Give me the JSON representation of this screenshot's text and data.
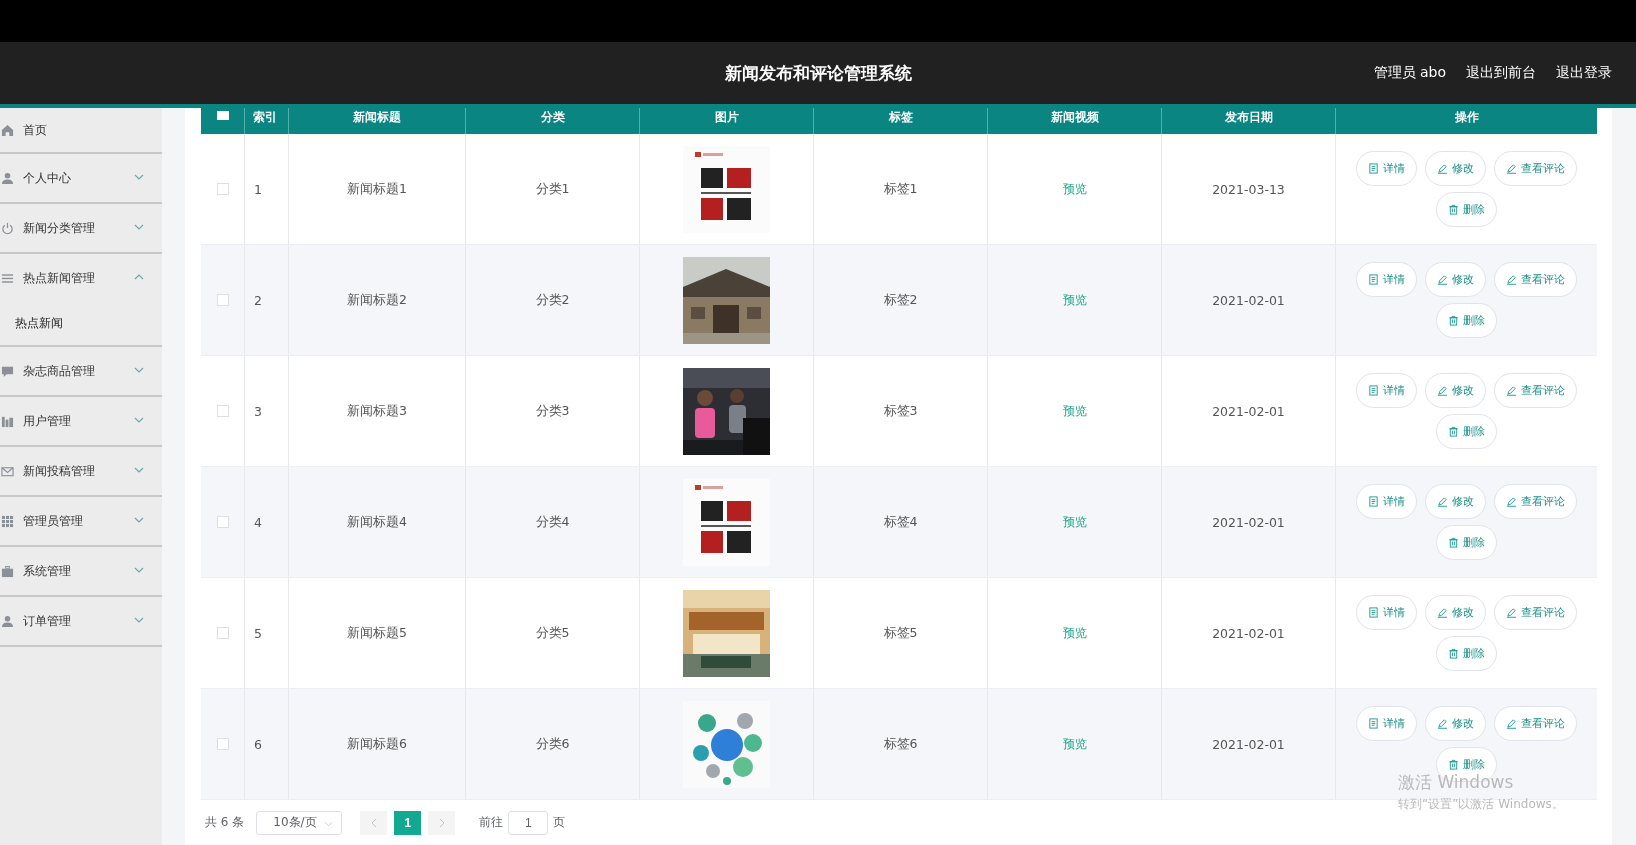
{
  "header": {
    "title": "新闻发布和评论管理系统",
    "user": "管理员 abo",
    "links": [
      "退出到前台",
      "退出登录"
    ]
  },
  "sidebar": {
    "items": [
      {
        "label": "首页",
        "has_children": false
      },
      {
        "label": "个人中心",
        "expanded": false,
        "has_children": true
      },
      {
        "label": "新闻分类管理",
        "expanded": false,
        "has_children": true
      },
      {
        "label": "热点新闻管理",
        "expanded": true,
        "has_children": true,
        "children": [
          {
            "label": "热点新闻"
          }
        ]
      },
      {
        "label": "杂志商品管理",
        "expanded": false,
        "has_children": true
      },
      {
        "label": "用户管理",
        "expanded": false,
        "has_children": true
      },
      {
        "label": "新闻投稿管理",
        "expanded": false,
        "has_children": true
      },
      {
        "label": "管理员管理",
        "expanded": false,
        "has_children": true
      },
      {
        "label": "系统管理",
        "expanded": false,
        "has_children": true
      },
      {
        "label": "订单管理",
        "expanded": false,
        "has_children": true
      }
    ]
  },
  "table": {
    "select_all_checked": false,
    "columns": [
      "索引",
      "新闻标题",
      "分类",
      "图片",
      "标签",
      "新闻视频",
      "发布日期",
      "操作"
    ],
    "rows": [
      {
        "checked": false,
        "index": "1",
        "title": "新闻标题1",
        "category": "分类1",
        "tag": "标签1",
        "video": "预览",
        "date": "2021-03-13",
        "actions": [
          "详情",
          "修改",
          "查看评论",
          "删除"
        ]
      },
      {
        "checked": false,
        "index": "2",
        "title": "新闻标题2",
        "category": "分类2",
        "tag": "标签2",
        "video": "预览",
        "date": "2021-02-01",
        "actions": [
          "详情",
          "修改",
          "查看评论",
          "删除"
        ]
      },
      {
        "checked": false,
        "index": "3",
        "title": "新闻标题3",
        "category": "分类3",
        "tag": "标签3",
        "video": "预览",
        "date": "2021-02-01",
        "actions": [
          "详情",
          "修改",
          "查看评论",
          "删除"
        ]
      },
      {
        "checked": false,
        "index": "4",
        "title": "新闻标题4",
        "category": "分类4",
        "tag": "标签4",
        "video": "预览",
        "date": "2021-02-01",
        "actions": [
          "详情",
          "修改",
          "查看评论",
          "删除"
        ]
      },
      {
        "checked": false,
        "index": "5",
        "title": "新闻标题5",
        "category": "分类5",
        "tag": "标签5",
        "video": "预览",
        "date": "2021-02-01",
        "actions": [
          "详情",
          "修改",
          "查看评论",
          "删除"
        ]
      },
      {
        "checked": false,
        "index": "6",
        "title": "新闻标题6",
        "category": "分类6",
        "tag": "标签6",
        "video": "预览",
        "date": "2021-02-01",
        "actions": [
          "详情",
          "修改",
          "查看评论",
          "删除"
        ]
      }
    ]
  },
  "pagination": {
    "total": "共 6 条",
    "page_size": "10条/页",
    "pages": [
      {
        "label": "1",
        "selected": true
      }
    ],
    "goto_label": "前往",
    "goto_value": "1",
    "goto_suffix": "页"
  },
  "activation_notice": {
    "title": "激活 Windows",
    "subtitle": "转到“设置”以激活 Windows。"
  }
}
